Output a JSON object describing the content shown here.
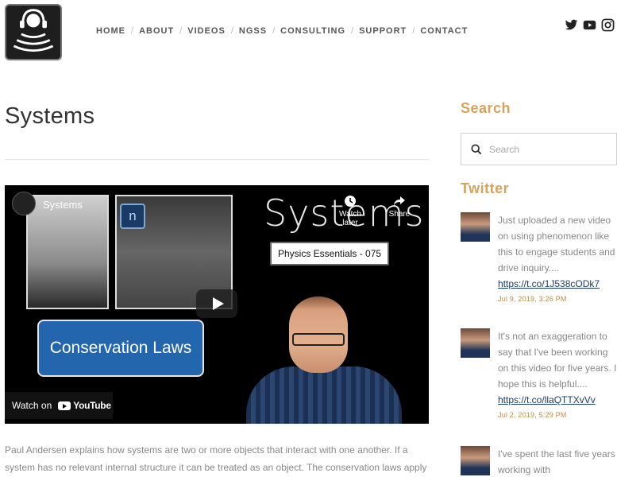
{
  "header": {
    "nav": [
      "HOME",
      "ABOUT",
      "VIDEOS",
      "NGSS",
      "CONSULTING",
      "SUPPORT",
      "CONTACT"
    ],
    "social": [
      "twitter-icon",
      "youtube-icon",
      "instagram-icon"
    ]
  },
  "main": {
    "title": "Systems",
    "video": {
      "title": "Systems",
      "big_title": "Systems",
      "watch_later": "Watch later",
      "share": "Share",
      "series_label": "Physics Essentials - 075",
      "badge_letter": "n",
      "concept_label": "Conservation Laws",
      "watch_on": "Watch on",
      "youtube": "YouTube"
    },
    "description": "Paul Andersen explains how systems are two or more objects that interact with one another. If a system has no relevant internal structure it can be treated as an object. The conservation laws apply to energy, charge and momentum in a system."
  },
  "sidebar": {
    "search_heading": "Search",
    "search_placeholder": "Search",
    "twitter_heading": "Twitter",
    "tweets": [
      {
        "text": "Just uploaded a new video on using phenomenon like this to engage students and drive inquiry....",
        "link": "https://t.co/1J538cODk7",
        "date": "Jul 9, 2019, 3:26 PM"
      },
      {
        "text": "It's not an exaggeration to say that I've been working on this video for five years. I hope this is helpful....",
        "link": "https://t.co/llaQTTXvVv",
        "date": "Jul 2, 2019, 5:29 PM"
      },
      {
        "text": "I've spent the last five years working with",
        "link": "",
        "date": ""
      }
    ]
  },
  "colors": {
    "accent": "#d4a45c",
    "link": "#1e3b66",
    "concept_blue": "#2466ad"
  }
}
